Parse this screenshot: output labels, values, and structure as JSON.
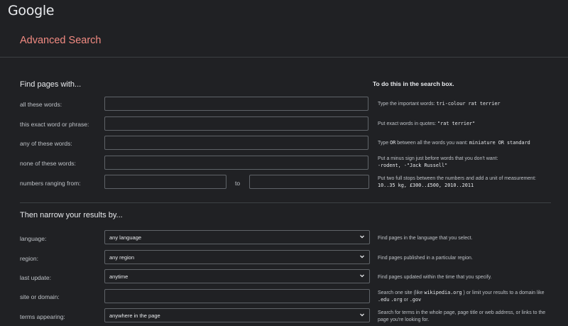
{
  "header": {
    "logo": "Google",
    "title": "Advanced Search"
  },
  "find_section": {
    "heading": "Find pages with...",
    "column_heading": "To do this in the search box.",
    "rows": [
      {
        "label": "all these words:",
        "hint_pre": "Type the important words: ",
        "hint_code": "tri-colour rat terrier"
      },
      {
        "label": "this exact word or phrase:",
        "hint_pre": "Put exact words in quotes: ",
        "hint_code": "\"rat terrier\""
      },
      {
        "label": "any of these words:",
        "hint_pre": "Type ",
        "hint_code_1": "OR",
        "hint_mid": " between all the words you want: ",
        "hint_code": "miniature OR standard"
      },
      {
        "label": "none of these words:",
        "hint_pre": "Put a minus sign just before words that you don't want:",
        "hint_code": "-rodent, -\"Jack Russell\""
      },
      {
        "label": "numbers ranging from:",
        "to_label": "to",
        "hint_pre": "Put two full stops between the numbers and add a unit of measurement:",
        "hint_code": "10..35 kg, £300..£500, 2010..2011"
      }
    ]
  },
  "narrow_section": {
    "heading": "Then narrow your results by...",
    "rows": [
      {
        "label": "language:",
        "value": "any language",
        "hint": "Find pages in the language that you select."
      },
      {
        "label": "region:",
        "value": "any region",
        "hint": "Find pages published in a particular region."
      },
      {
        "label": "last update:",
        "value": "anytime",
        "hint": "Find pages updated within the time that you specify."
      },
      {
        "label": "site or domain:",
        "hint_pre": "Search one site (like ",
        "hint_code_1": "wikipedia.org",
        "hint_mid": " ) or limit your results to a domain like ",
        "hint_code_2": ".edu",
        "hint_code_3": ".org",
        "hint_or": " or ",
        "hint_code_4": ".gov"
      },
      {
        "label": "terms appearing:",
        "value": "anywhere in the page",
        "hint": "Search for terms in the whole page, page title or web address, or links to the page you're looking for."
      }
    ]
  },
  "icons": {
    "dropdown": "chevron-down-icon"
  }
}
